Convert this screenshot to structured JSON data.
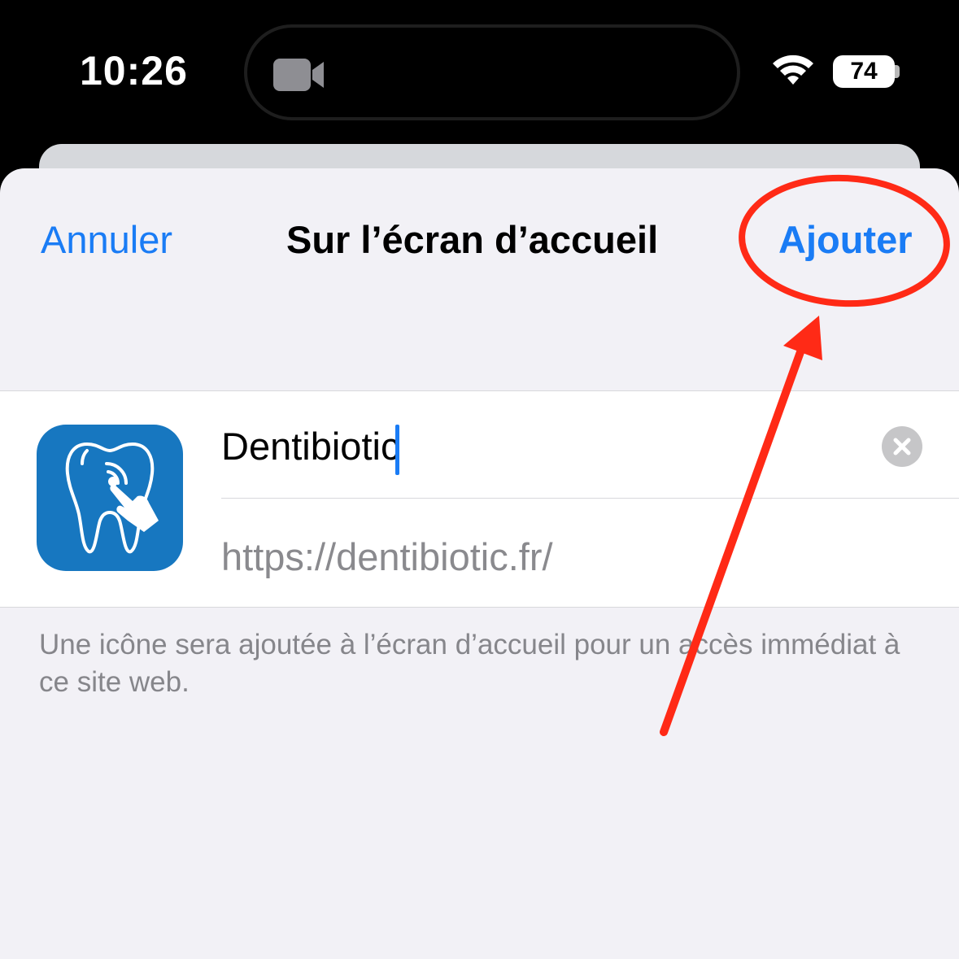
{
  "status_bar": {
    "time": "10:26",
    "battery": "74"
  },
  "sheet": {
    "cancel_label": "Annuler",
    "title": "Sur l’écran d’accueil",
    "add_label": "Ajouter"
  },
  "form": {
    "name_value": "Dentibiotic",
    "url": "https://dentibiotic.fr/"
  },
  "footnote": "Une icône sera ajoutée à l’écran d’accueil pour un accès immédiat à ce site web.",
  "colors": {
    "accent": "#1a7cf5",
    "app_icon_bg": "#1777c0",
    "annotation": "#ff2a16"
  },
  "icons": [
    "facetime-camera-icon",
    "wifi-icon",
    "battery-icon",
    "tooth-touch-app-icon",
    "clear-x-icon"
  ]
}
